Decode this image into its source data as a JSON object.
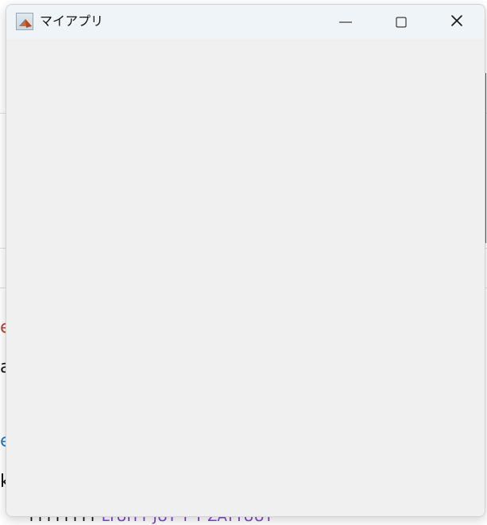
{
  "window": {
    "title": "マイアプリ"
  },
  "icons": {
    "app": "matlab-app-icon",
    "minimize": "minimize-icon",
    "maximize": "maximize-icon",
    "close": "close-icon"
  },
  "colors": {
    "titlebar": "#eef4f8",
    "content": "#f0f0f0",
    "background_accent": "#2e6b8f",
    "background_purple_text": "#7b48c8",
    "background_red_letter": "#b24a3a",
    "background_blue_letter": "#2c7bbd"
  },
  "background": {
    "left_letters": [
      "e",
      "a",
      "e",
      "k"
    ],
    "bottom_text_left": "YYYYYYYY",
    "bottom_text_purple": "LYUIYY JUY Y Y ZAYYUUY"
  }
}
